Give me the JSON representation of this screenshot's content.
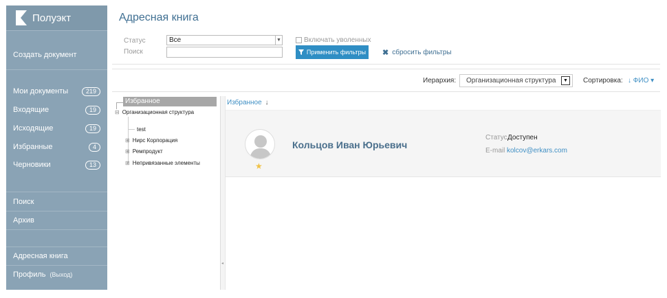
{
  "app": {
    "brand": "Полуэкт"
  },
  "sidebar": {
    "create_document": "Создать документ",
    "items": [
      {
        "label": "Мои документы",
        "badge": "219"
      },
      {
        "label": "Входящие",
        "badge": "19"
      },
      {
        "label": "Исходящие",
        "badge": "19"
      },
      {
        "label": "Избранные",
        "badge": "4"
      },
      {
        "label": "Черновики",
        "badge": "13"
      }
    ],
    "search": "Поиск",
    "archive": "Архив",
    "address_book": "Адресная книга",
    "profile": "Профиль",
    "logout": "(Выход)"
  },
  "filters": {
    "title": "Адресная книга",
    "status_label": "Статус",
    "status_value": "Все",
    "search_label": "Поиск",
    "search_value": "",
    "include_fired": "Включать уволенных",
    "apply_button": "Применить фильтры",
    "reset_link": "сбросить фильтры"
  },
  "hierarchy": {
    "label": "Иерархия:",
    "value": "Организационная структура",
    "sort_label": "Сортировка:",
    "sort_value": "↓ ФИО ▾"
  },
  "tree": {
    "header": "Избранное",
    "root": "Организационная структура",
    "children": [
      "test",
      "Нирс Корпорация",
      "Ремпродукт",
      "Непривязанные элементы"
    ]
  },
  "list": {
    "breadcrumb": "Избранное",
    "breadcrumb_arrow": "↓",
    "person": {
      "name": "Кольцов Иван Юрьевич",
      "status_label": "Статус",
      "status_value": "Доступен",
      "email_label": "E-mail",
      "email_value": "kolcov@erkars.com",
      "favorite": true
    }
  },
  "colors": {
    "sidebar": "#8aa3b5",
    "accent": "#2f8ec4",
    "link": "#3f8fc4",
    "star": "#f0c246"
  }
}
